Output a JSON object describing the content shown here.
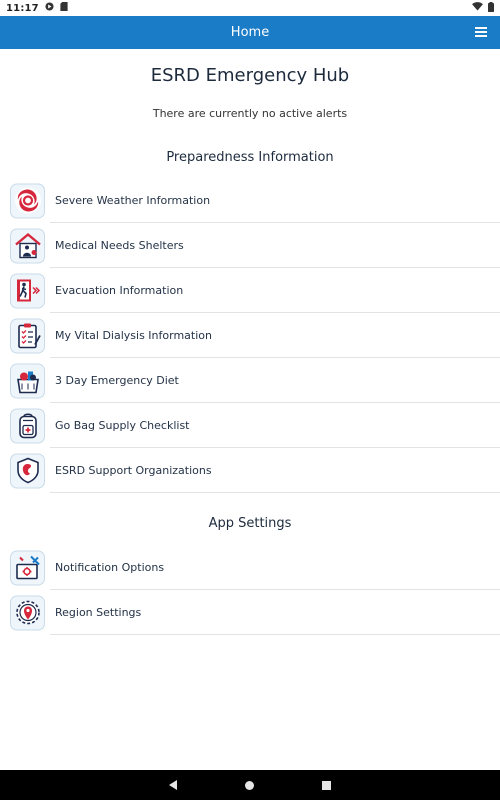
{
  "status_bar": {
    "time": "11:17",
    "icons": [
      "play-store-icon",
      "sd-card-icon",
      "wifi-icon",
      "battery-icon"
    ]
  },
  "app_bar": {
    "title": "Home",
    "menu_icon": "hamburger-menu-icon",
    "color": "#1a7bc7"
  },
  "main": {
    "title": "ESRD Emergency Hub",
    "alerts_text": "There are currently no active alerts",
    "preparedness_heading": "Preparedness Information",
    "preparedness_items": [
      {
        "label": "Severe Weather Information",
        "icon": "hurricane-icon"
      },
      {
        "label": "Medical Needs Shelters",
        "icon": "shelter-icon"
      },
      {
        "label": "Evacuation Information",
        "icon": "evacuation-exit-icon"
      },
      {
        "label": "My Vital Dialysis Information",
        "icon": "clipboard-checklist-icon"
      },
      {
        "label": "3 Day Emergency Diet",
        "icon": "groceries-icon"
      },
      {
        "label": "Go Bag Supply Checklist",
        "icon": "backpack-icon"
      },
      {
        "label": "ESRD Support Organizations",
        "icon": "kidney-shield-icon"
      }
    ],
    "settings_heading": "App Settings",
    "settings_items": [
      {
        "label": "Notification Options",
        "icon": "notification-tools-icon"
      },
      {
        "label": "Region Settings",
        "icon": "region-gear-icon"
      }
    ]
  },
  "colors": {
    "accent": "#1a7bc7",
    "icon_red": "#d6283c",
    "icon_navy": "#1d2b4f"
  }
}
